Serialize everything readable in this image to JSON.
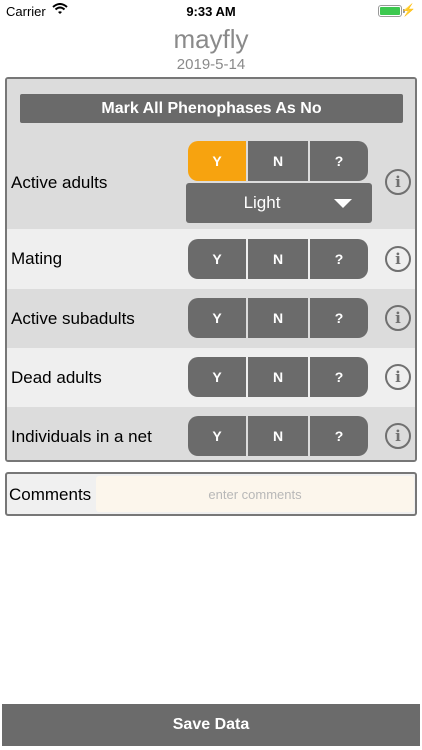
{
  "status_bar": {
    "carrier": "Carrier",
    "time": "9:33 AM",
    "charging_icon": "bolt-icon"
  },
  "header": {
    "title": "mayfly",
    "date": "2019-5-14"
  },
  "mark_all_label": "Mark All Phenophases As No",
  "option_labels": {
    "yes": "Y",
    "no": "N",
    "unknown": "?"
  },
  "info_icon_glyph": "i",
  "phenophases": [
    {
      "label": "Active adults",
      "selected": "Y",
      "intensity": "Light"
    },
    {
      "label": "Mating",
      "selected": null
    },
    {
      "label": "Active subadults",
      "selected": null
    },
    {
      "label": "Dead adults",
      "selected": null
    },
    {
      "label": "Individuals in a net",
      "selected": null
    }
  ],
  "comments": {
    "label": "Comments",
    "placeholder": "enter comments",
    "value": ""
  },
  "save_label": "Save Data",
  "colors": {
    "selected": "#f7a30f",
    "button": "#6b6b6b",
    "row_shade": "#dcdcdc",
    "row_light": "#efefef",
    "comment_field": "#fcf6ec"
  }
}
